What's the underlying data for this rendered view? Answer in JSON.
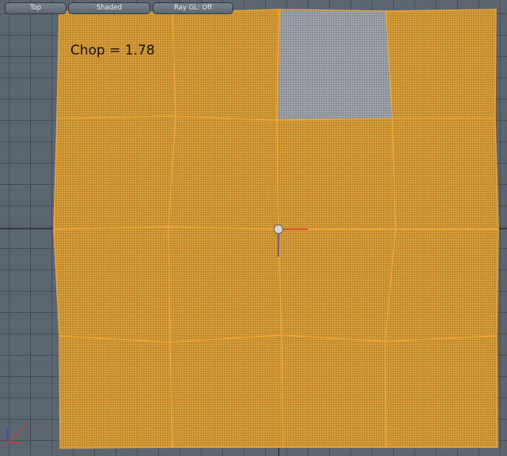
{
  "toolbar": {
    "view_label": "Top",
    "shading_label": "Shaded",
    "raygl_label": "Ray GL: Off"
  },
  "overlay": {
    "chop_text": "Chop = 1.78"
  },
  "colors": {
    "background": "#5b6670",
    "mesh_fill": "#b58a2e",
    "mesh_wire": "#e9a23a",
    "unselected_fill": "#8a8f96",
    "axis_x": "#d23a2a",
    "axis_y": "#4a40c8"
  },
  "icons": {
    "pivot": "pivot-handle-icon",
    "corner_axes": "axis-gizmo-icon"
  }
}
